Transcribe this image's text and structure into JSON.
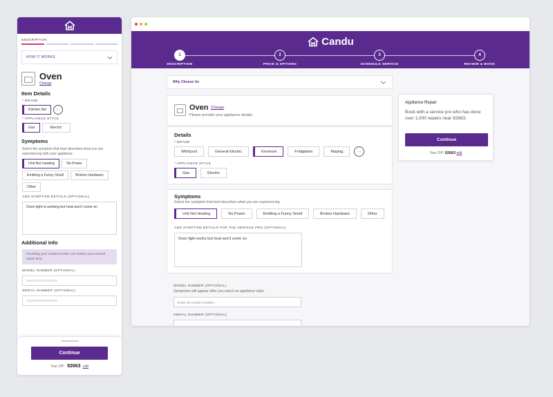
{
  "mobile": {
    "step_label": "DESCRIPTION",
    "how_it_works": "HOW IT WORKS",
    "item_title": "Oven",
    "change_link": "Change",
    "item_details_heading": "Item Details",
    "brand_label": "* BRAND",
    "brand_selected": "Kitchen Aid",
    "more_label": "···",
    "appliance_style_label": "* APPLIANCE STYLE",
    "styles": [
      "Gas",
      "Electric"
    ],
    "symptoms_heading": "Symptoms",
    "symptoms_text": "Select the symptom that best describes what you are experiencing with your appliance.",
    "symptoms": [
      "Unit Not Heating",
      "No Power",
      "Emitting a Funny Smell",
      "Broken Hardware",
      "Other"
    ],
    "symptom_details_label": "ADD SYMPTOM DETAILS (OPTIONAL)",
    "symptom_details_value": "Oven light is working but heat won't come on",
    "additional_heading": "Additional Info",
    "additional_note": "Providing your model number can reduce your overall repair time.",
    "model_label": "MODEL NUMBER (OPTIONAL)",
    "model_placeholder": "XXXXXXXXXXXXXXX",
    "serial_label": "SERIAL NUMBER (OPTIONAL)",
    "serial_placeholder": "XXXXXXXXXXXXXXX",
    "continue": "Continue",
    "zip_prefix": "Your ZIP:",
    "zip": "92663",
    "edit": "edit"
  },
  "desktop": {
    "brand_name": "Candu",
    "steps": [
      {
        "num": "1",
        "label": "DESCRIPTION"
      },
      {
        "num": "2",
        "label": "PRICE & OPTIONS"
      },
      {
        "num": "3",
        "label": "SCHEDULE SERVICE"
      },
      {
        "num": "4",
        "label": "REVIEW & BOOK"
      }
    ],
    "why_choose_us": "Why Choose Us",
    "item_title": "Oven",
    "change_link": "Change",
    "item_subtitle": "Please provide your appliance details.",
    "details_heading": "Details",
    "brand_label": "* BRAND",
    "brands": [
      "Whirlpool",
      "General Electric",
      "Kenmore",
      "Fridgidaire",
      "Maytag"
    ],
    "more_label": "···",
    "appliance_style_label": "* APPLIANCE STYLE",
    "styles": [
      "Gas",
      "Electric"
    ],
    "symptoms_heading": "Symptoms",
    "symptoms_text": "Select the symptom that best describes what you are experiencing",
    "symptoms": [
      "Unit Not Heating",
      "No Power",
      "Emitting a Funny Smell",
      "Broken Hardware",
      "Other"
    ],
    "symptom_details_label": "ADD SYMPTOM DETAILS FOR THE SERVICE PRO (OPTIONAL)",
    "symptom_details_value": "Oven light works but heat won't come on",
    "model_label": "MODEL NUMBER (OPTIONAL)",
    "model_hint": "Symptoms will appear after you select an appliance style.",
    "model_placeholder": "Enter an model number...",
    "serial_label": "SERIAL NUMBER (OPTIONAL)",
    "side": {
      "title": "Appliance Repair",
      "text": "Book with a service pro who has done over 1,000 repairs near 92663.",
      "continue": "Continue",
      "zip_prefix": "Your ZIP:",
      "zip": "92663",
      "edit": "edit"
    }
  },
  "colors": {
    "brand": "#5a2a8e",
    "progress_active": "#e0336d",
    "window_dots": [
      "#e0336d",
      "#f5a623",
      "#9acd32"
    ]
  }
}
